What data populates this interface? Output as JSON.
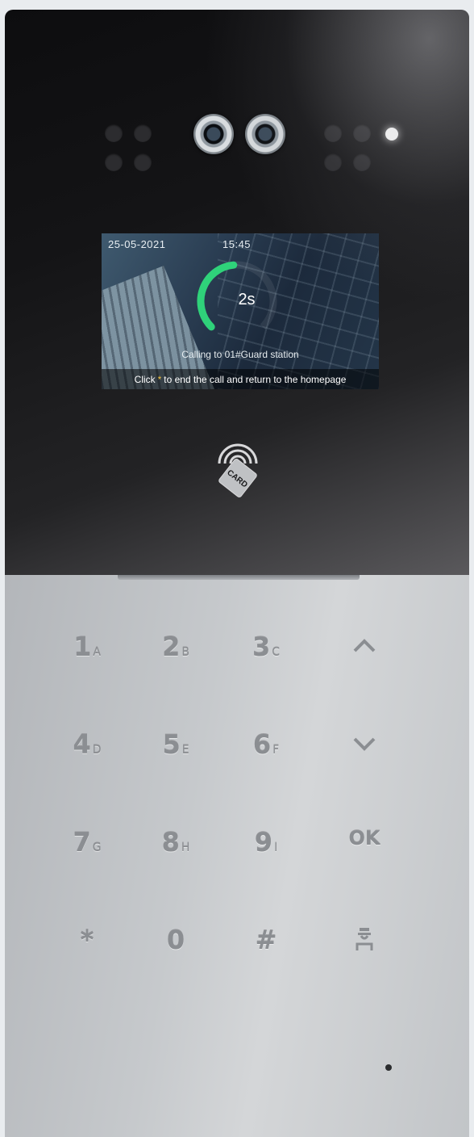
{
  "screen": {
    "date": "25-05-2021",
    "time": "15:45",
    "countdown": "2s",
    "progress": 0.4,
    "calling_text": "Calling to 01#Guard station",
    "hint_prefix": "Click",
    "hint_star": "*",
    "hint_suffix": "to end the call and return to the homepage",
    "accent_color": "#2fd27a"
  },
  "card_reader": {
    "label": "CARD",
    "icon": "nfc-card-icon"
  },
  "keypad": {
    "keys": [
      {
        "num": "1",
        "letter": "A"
      },
      {
        "num": "2",
        "letter": "B"
      },
      {
        "num": "3",
        "letter": "C"
      },
      {
        "icon": "chevron-up-icon"
      },
      {
        "num": "4",
        "letter": "D"
      },
      {
        "num": "5",
        "letter": "E"
      },
      {
        "num": "6",
        "letter": "F"
      },
      {
        "icon": "chevron-down-icon"
      },
      {
        "num": "7",
        "letter": "G"
      },
      {
        "num": "8",
        "letter": "H"
      },
      {
        "num": "9",
        "letter": "I"
      },
      {
        "num": "OK"
      },
      {
        "num": "*"
      },
      {
        "num": "0"
      },
      {
        "num": "#"
      },
      {
        "icon": "guard-icon"
      }
    ]
  }
}
